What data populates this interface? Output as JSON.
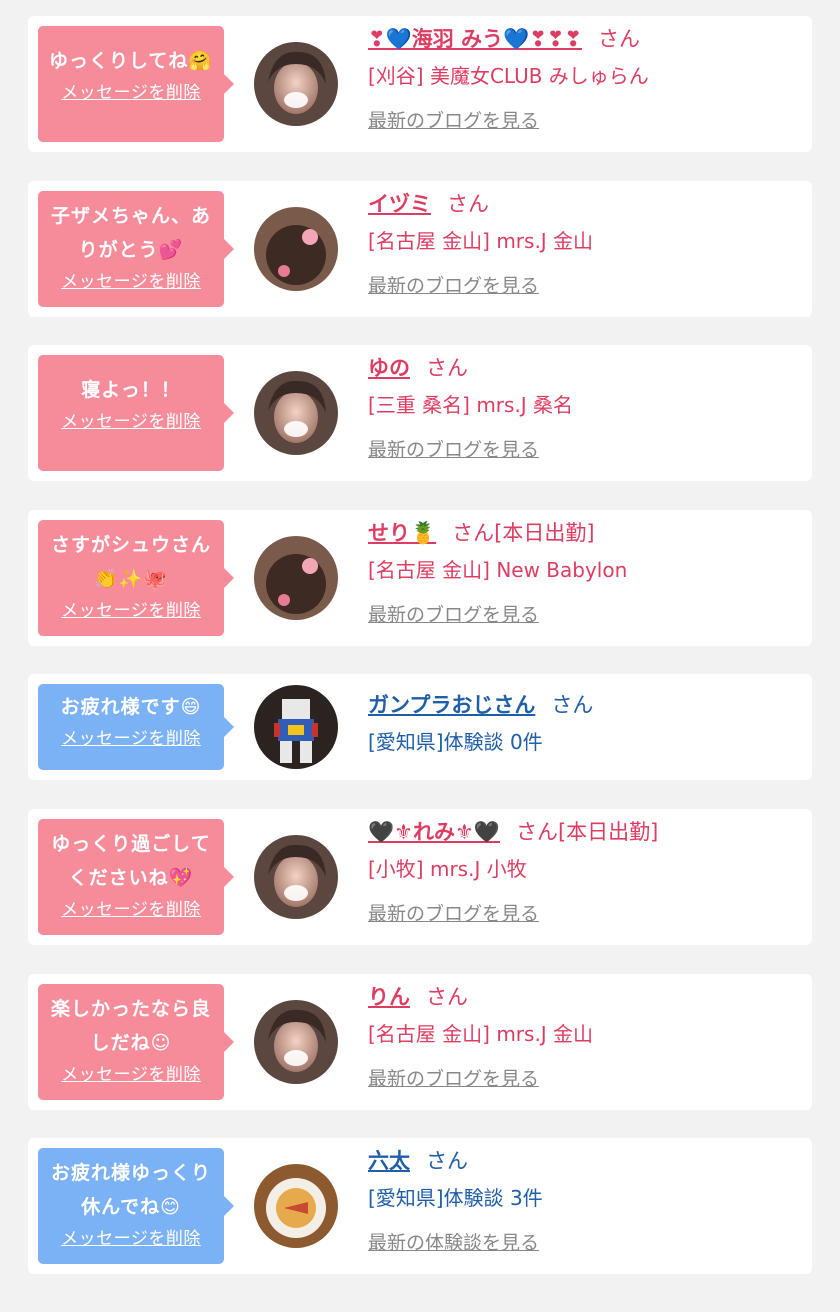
{
  "colors": {
    "page_bg": "#f2f2f2",
    "card_bg": "#ffffff",
    "bubble_pink": "#f68c9a",
    "bubble_blue": "#7bb1f5",
    "text_pink": "#de3d62",
    "text_blue": "#1f5ea8",
    "link_gray": "#888888"
  },
  "entries": [
    {
      "type": "girl",
      "message": "ゆっくりしてね🤗",
      "delete_label": "メッセージを削除",
      "avatar": "photo-woman-icon",
      "name": "❣💙海羽 みう💙❣❣❣",
      "honorific": "さん",
      "status": "",
      "shop": "[刈谷] 美魔女CLUB みしゅらん",
      "link_label": "最新のブログを見る"
    },
    {
      "type": "girl",
      "message": "子ザメちゃん、ありがとう💕",
      "delete_label": "メッセージを削除",
      "avatar": "photo-hair-icon",
      "name": "イヅミ",
      "honorific": "さん",
      "status": "",
      "shop": "[名古屋 金山] mrs.J 金山",
      "link_label": "最新のブログを見る"
    },
    {
      "type": "girl",
      "message": "寝よっ！！",
      "delete_label": "メッセージを削除",
      "avatar": "photo-woman-icon",
      "name": "ゆの",
      "honorific": "さん",
      "status": "",
      "shop": "[三重 桑名] mrs.J 桑名",
      "link_label": "最新のブログを見る"
    },
    {
      "type": "girl",
      "message": "さすがシュウさん👏✨🐙",
      "delete_label": "メッセージを削除",
      "avatar": "photo-hair-icon",
      "name": "せり🍍",
      "honorific": "さん",
      "status": "[本日出勤]",
      "shop": "[名古屋 金山] New Babylon",
      "link_label": "最新のブログを見る"
    },
    {
      "type": "user",
      "message": "お疲れ様です😄",
      "delete_label": "メッセージを削除",
      "avatar": "photo-robot-icon",
      "name": "ガンプラおじさん",
      "honorific": "さん",
      "status": "",
      "shop": "[愛知県]体験談 0件",
      "link_label": ""
    },
    {
      "type": "girl",
      "message": "ゆっくり過ごしてくださいね💖",
      "delete_label": "メッセージを削除",
      "avatar": "photo-woman-icon",
      "name": "🖤⚜れみ⚜🖤",
      "honorific": "さん",
      "status": "[本日出勤]",
      "shop": "[小牧] mrs.J 小牧",
      "link_label": "最新のブログを見る"
    },
    {
      "type": "girl",
      "message": "楽しかったなら良しだね☺",
      "delete_label": "メッセージを削除",
      "avatar": "photo-woman-icon",
      "name": "りん",
      "honorific": "さん",
      "status": "",
      "shop": "[名古屋 金山] mrs.J 金山",
      "link_label": "最新のブログを見る"
    },
    {
      "type": "user",
      "message": "お疲れ様ゆっくり休んでね😊",
      "delete_label": "メッセージを削除",
      "avatar": "photo-food-icon",
      "name": "六太",
      "honorific": "さん",
      "status": "",
      "shop": "[愛知県]体験談 3件",
      "link_label": "最新の体験談を見る"
    }
  ]
}
